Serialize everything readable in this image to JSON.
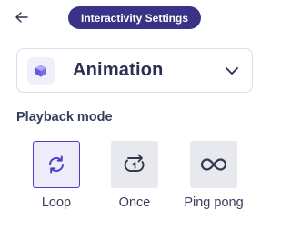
{
  "header": {
    "back_icon": "arrow-left-icon",
    "title": "Interactivity Settings",
    "title_bg": "#3a3287"
  },
  "dropdown": {
    "icon": "cube-icon",
    "label": "Animation",
    "chevron_icon": "chevron-down-icon"
  },
  "playback": {
    "title": "Playback mode",
    "selected": "Loop",
    "accent": "#4b3fce",
    "options": [
      {
        "label": "Loop",
        "icon": "loop-icon"
      },
      {
        "label": "Once",
        "icon": "repeat-once-icon"
      },
      {
        "label": "Ping pong",
        "icon": "infinity-icon"
      }
    ]
  }
}
